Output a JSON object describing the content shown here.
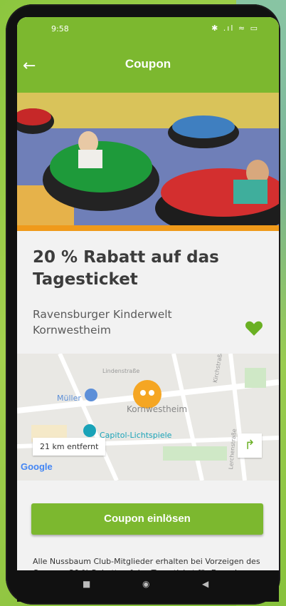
{
  "status_bar": {
    "time": "9:58",
    "icons": "✱ .ıl ≈ ▭"
  },
  "app_bar": {
    "back_icon": "←",
    "title": "Coupon"
  },
  "coupon": {
    "title": "20 % Rabatt auf das Tagesticket",
    "venue": "Ravensburger Kinderwelt Kornwestheim",
    "favorite_icon": "heart-icon",
    "accent_color": "#7cb82f"
  },
  "map": {
    "labels": {
      "mueller": "Müller",
      "kornwestheim": "Kornwestheim",
      "capitol": "Capitol-Lichtspiele",
      "street1": "Lindenstraße",
      "street2": "Kirchstraße",
      "street3": "Lerchenstraße"
    },
    "distance": "21 km entfernt",
    "google": "Google"
  },
  "actions": {
    "redeem": "Coupon einlösen"
  },
  "description": "Alle Nussbaum Club-Mitglieder erhalten bei Vorzeigen des Coupons 20 % Rabatt auf das Tagesticket für Erwachsene und Kinder."
}
